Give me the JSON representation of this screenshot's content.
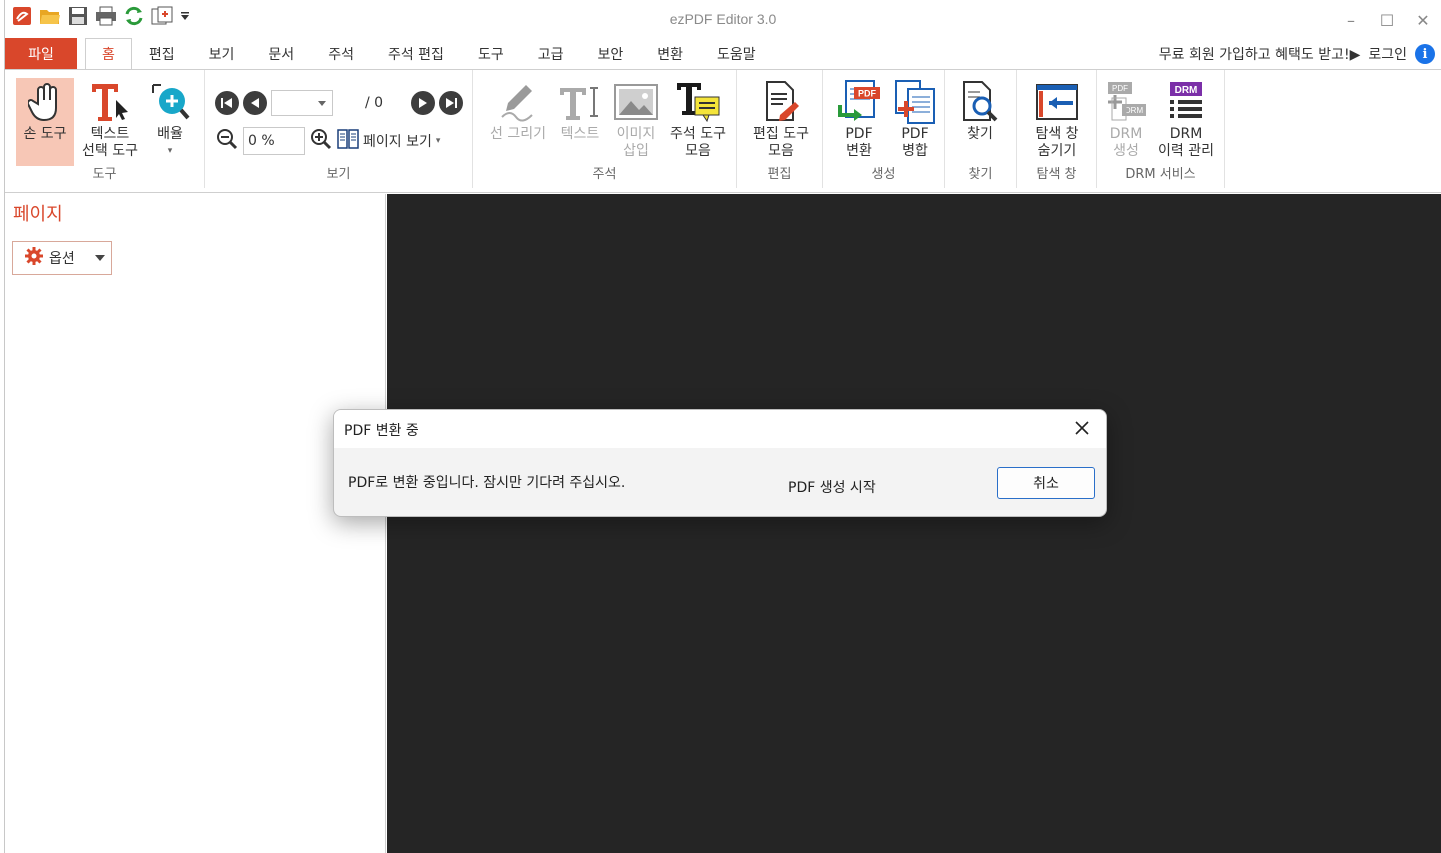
{
  "app": {
    "title": "ezPDF Editor 3.0"
  },
  "quick_access": [
    "ezpdf-logo-icon",
    "open-folder-icon",
    "save-icon",
    "print-icon",
    "refresh-icon",
    "new-document-icon",
    "dropdown-icon"
  ],
  "window_controls": {
    "minimize": "–",
    "maximize": "☐",
    "close": "✕"
  },
  "menu": {
    "file": "파일",
    "tabs": [
      "홈",
      "편집",
      "보기",
      "문서",
      "주석",
      "주석 편집",
      "도구",
      "고급",
      "보안",
      "변환",
      "도움말"
    ],
    "active_tab": "홈",
    "promo": "무료 회원 가입하고 혜택도 받고!▶",
    "login": "로그인"
  },
  "ribbon": {
    "tools": {
      "label": "도구",
      "hand": "손 도구",
      "text_select_1": "텍스트",
      "text_select_2": "선택 도구",
      "zoom": "배율"
    },
    "view": {
      "label": "보기",
      "page_total": "/ 0",
      "zoom_value": "0 %",
      "page_view": "페이지 보기"
    },
    "annotation": {
      "label": "주석",
      "draw_line": "선 그리기",
      "text": "텍스트",
      "image_insert_1": "이미지",
      "image_insert_2": "삽입",
      "annot_tools_1": "주석 도구",
      "annot_tools_2": "모음"
    },
    "edit": {
      "label": "편집",
      "edit_tools_1": "편집 도구",
      "edit_tools_2": "모음"
    },
    "create": {
      "label": "생성",
      "convert_1": "PDF",
      "convert_2": "변환",
      "merge_1": "PDF",
      "merge_2": "병합"
    },
    "find": {
      "label": "찾기",
      "find": "찾기"
    },
    "nav_pane": {
      "label": "탐색 창",
      "hide_1": "탐색 창",
      "hide_2": "숨기기"
    },
    "drm": {
      "label": "DRM 서비스",
      "create_1": "DRM",
      "create_2": "생성",
      "history_1": "DRM",
      "history_2": "이력 관리",
      "badge_pdf": "PDF",
      "badge_drm": "DRM"
    }
  },
  "left_panel": {
    "title": "페이지",
    "options": "옵션"
  },
  "dialog": {
    "title": "PDF 변환 중",
    "message": "PDF로 변환 중입니다. 잠시만 기다려 주십시오.",
    "status": "PDF 생성 시작",
    "cancel": "취소"
  },
  "colors": {
    "accent": "#d9472b",
    "document_bg": "#252525",
    "dialog_button_border": "#2a6fc9"
  }
}
